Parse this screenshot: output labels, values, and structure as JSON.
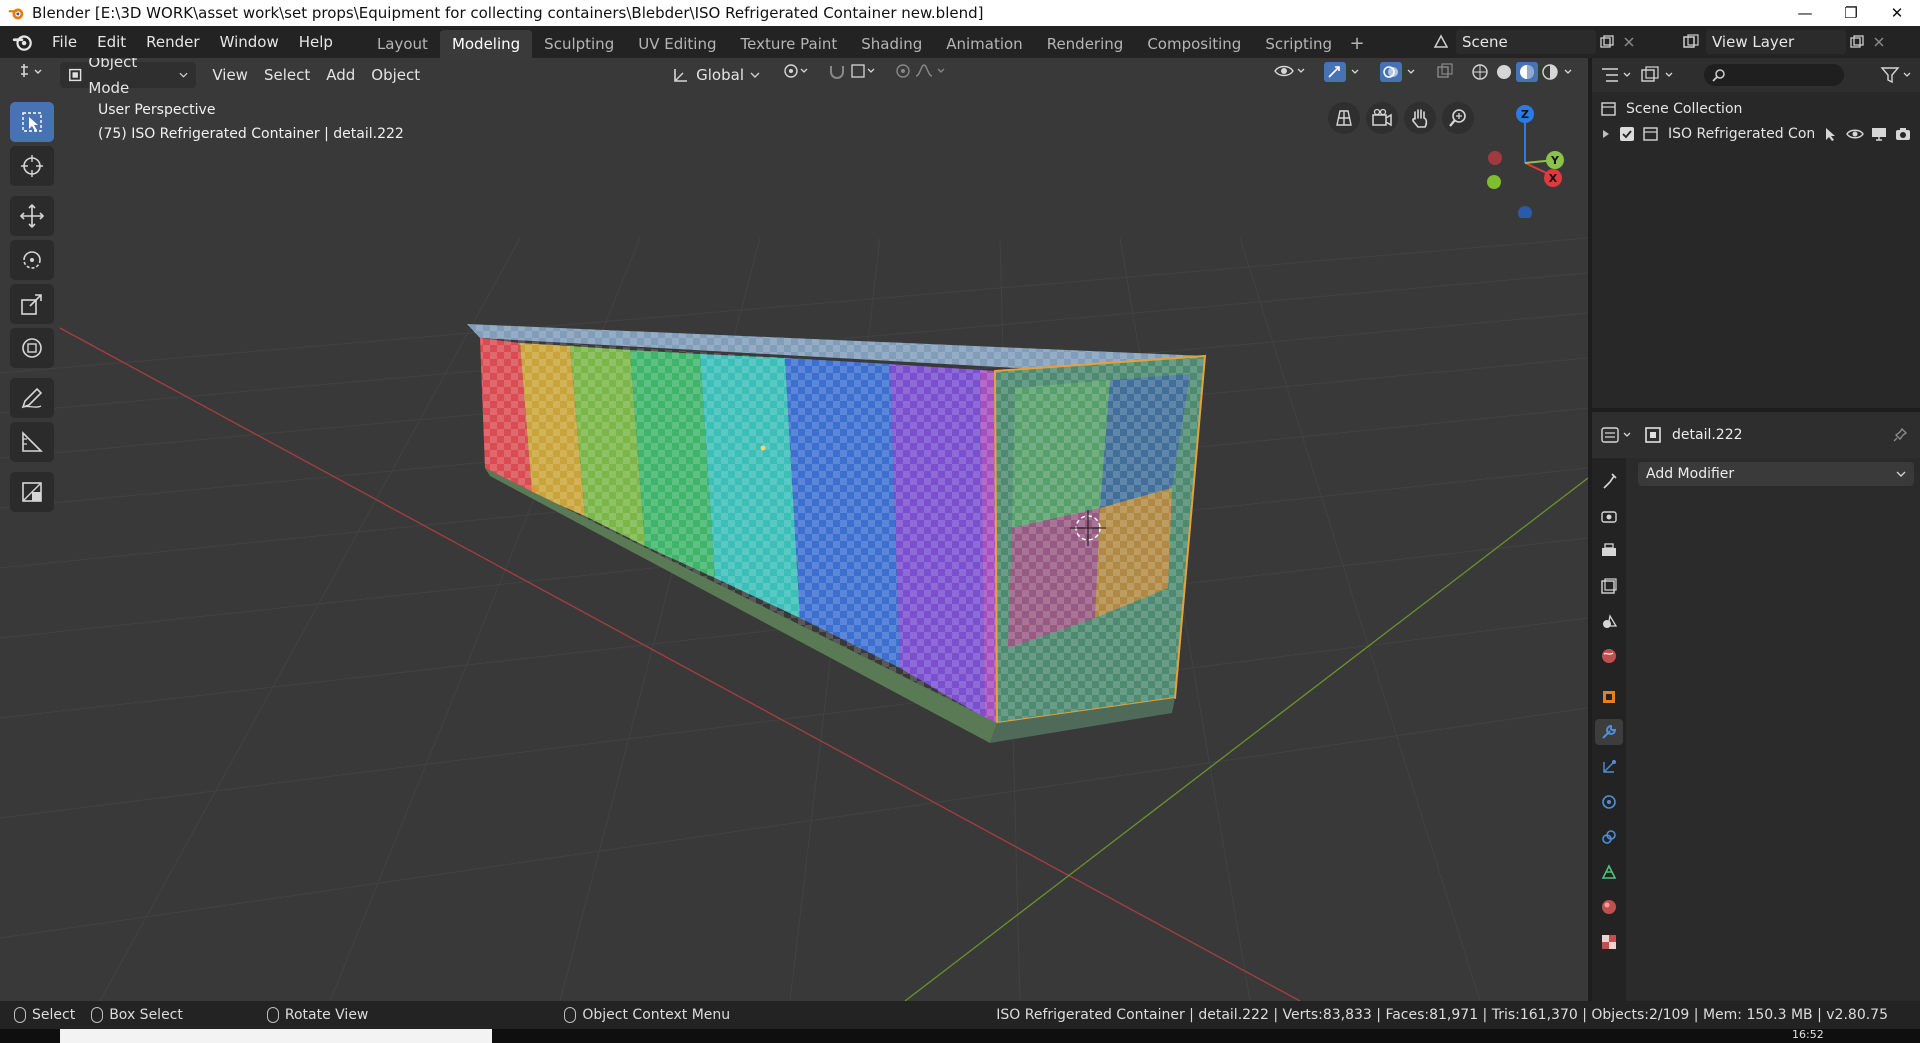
{
  "window": {
    "title": "Blender [E:\\3D WORK\\asset work\\set props\\Equipment for collecting containers\\Blebder\\ISO Refrigerated Container new.blend]",
    "minimize_glyph": "—",
    "restore_glyph": "❐",
    "close_glyph": "✕"
  },
  "menus": [
    "File",
    "Edit",
    "Render",
    "Window",
    "Help"
  ],
  "workspaces": [
    {
      "label": "Layout",
      "active": false
    },
    {
      "label": "Modeling",
      "active": true
    },
    {
      "label": "Sculpting",
      "active": false
    },
    {
      "label": "UV Editing",
      "active": false
    },
    {
      "label": "Texture Paint",
      "active": false
    },
    {
      "label": "Shading",
      "active": false
    },
    {
      "label": "Animation",
      "active": false
    },
    {
      "label": "Rendering",
      "active": false
    },
    {
      "label": "Compositing",
      "active": false
    },
    {
      "label": "Scripting",
      "active": false
    }
  ],
  "workspace_add": "+",
  "scene": {
    "name": "Scene"
  },
  "view_layer": {
    "name": "View Layer"
  },
  "viewport": {
    "mode": "Object Mode",
    "header_menus": [
      "View",
      "Select",
      "Add",
      "Object"
    ],
    "transform_orientation": "Global",
    "perspective_label": "User Perspective",
    "object_info": "(75) ISO Refrigerated Container | detail.222",
    "gizmo_axes": {
      "x": "X",
      "y": "Y",
      "z": "Z"
    }
  },
  "outliner": {
    "root": "Scene Collection",
    "items": [
      {
        "label": "ISO Refrigerated Conta",
        "checked": true
      }
    ]
  },
  "properties": {
    "object_name": "detail.222",
    "add_modifier": "Add Modifier",
    "active_tab": "modifier-tab"
  },
  "statusbar": {
    "select": "Select",
    "box_select": "Box Select",
    "rotate_view": "Rotate View",
    "context_menu": "Object Context Menu",
    "stats": "ISO Refrigerated Container | detail.222 | Verts:83,833 | Faces:81,971 | Tris:161,370 | Objects:2/109 | Mem: 150.3 MB | v2.80.75"
  },
  "taskbar": {
    "clock": "16:52"
  },
  "colors": {
    "accent": "#4772b3",
    "axis_x": "#e0393e",
    "axis_y": "#8bc34a",
    "axis_z": "#2c7be5",
    "container_stripes": [
      "#d94c52",
      "#c9a43a",
      "#7ab648",
      "#3fb56b",
      "#3bbfb8",
      "#3d6fd0",
      "#7a4fd0",
      "#a64fbf"
    ]
  }
}
